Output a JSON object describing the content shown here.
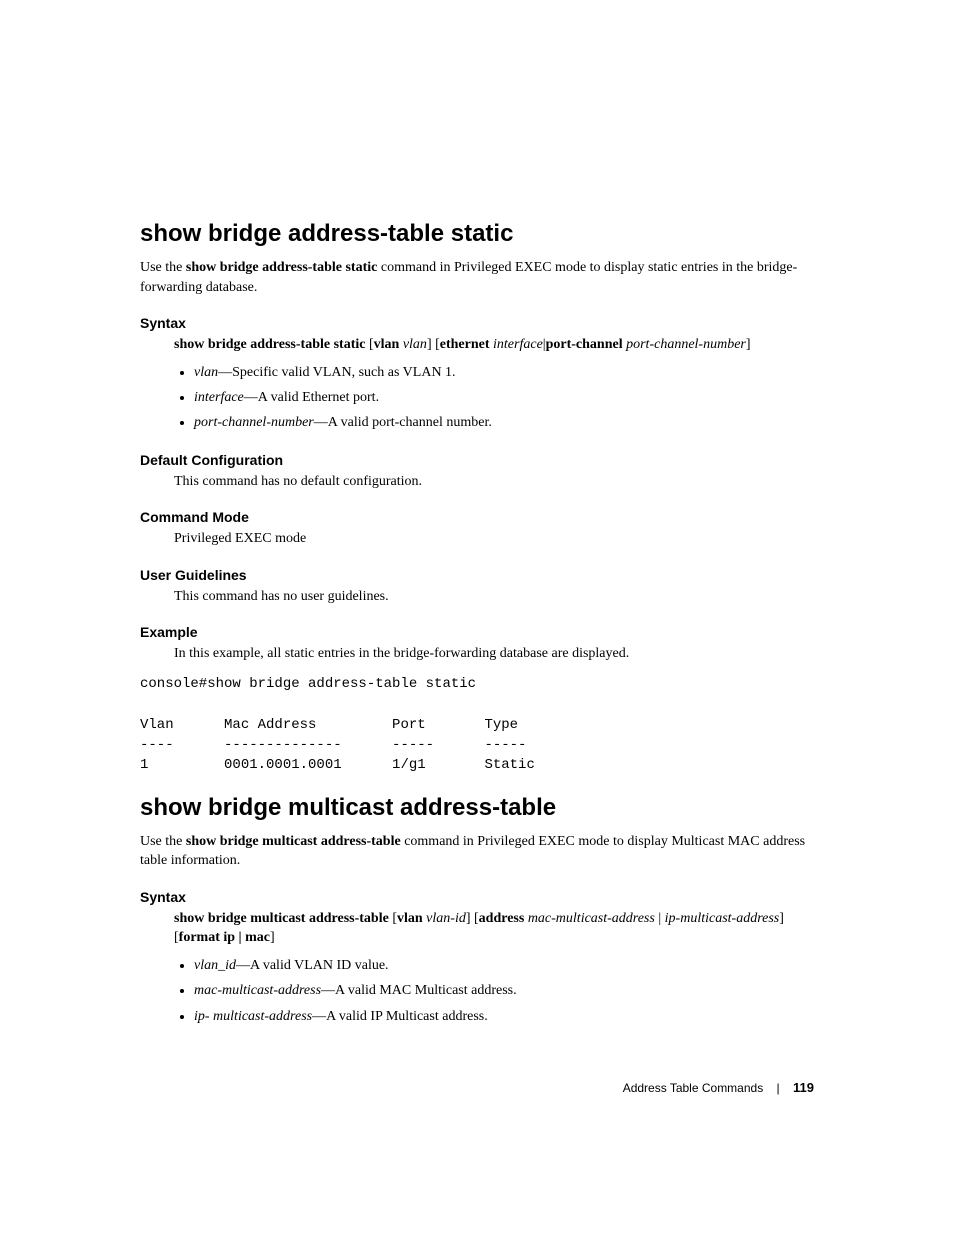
{
  "section1": {
    "title": "show bridge address-table static",
    "intro_pre": "Use the ",
    "intro_bold": "show bridge address-table static",
    "intro_post": " command in Privileged EXEC mode to display static entries in the bridge-forwarding database.",
    "syntax": {
      "heading": "Syntax",
      "line_b1": "show bridge address-table static",
      "line_t1": " [",
      "line_b2": "vlan",
      "line_i1": " vlan",
      "line_t2": "] [",
      "line_b3": "ethernet",
      "line_i2": " interface",
      "line_t3": "|",
      "line_b4": "port-channel",
      "line_i3": " port-channel-number",
      "line_t4": "]",
      "bullets": [
        {
          "term": "vlan",
          "desc": "—Specific valid VLAN, such as VLAN 1."
        },
        {
          "term": "interface",
          "desc": "—A valid Ethernet port."
        },
        {
          "term": "port-channel-number",
          "desc": "—A valid port-channel number."
        }
      ]
    },
    "default_config": {
      "heading": "Default Configuration",
      "text": "This command has no default configuration."
    },
    "command_mode": {
      "heading": "Command Mode",
      "text": "Privileged EXEC mode"
    },
    "user_guidelines": {
      "heading": "User Guidelines",
      "text": "This command has no user guidelines."
    },
    "example": {
      "heading": "Example",
      "text": "In this example, all static entries in the bridge-forwarding database are displayed.",
      "code": "console#show bridge address-table static\n\nVlan      Mac Address         Port       Type\n----      --------------      -----      -----\n1         0001.0001.0001      1/g1       Static"
    }
  },
  "section2": {
    "title": "show bridge multicast address-table",
    "intro_pre": "Use the ",
    "intro_bold": "show bridge multicast address-table",
    "intro_post": " command in Privileged EXEC mode to display Multicast MAC address table information.",
    "syntax": {
      "heading": "Syntax",
      "line_b1": "show bridge multicast address-table",
      "line_t1": " [",
      "line_b2": "vlan",
      "line_i1": " vlan-id",
      "line_t2": "] [",
      "line_b3": "address",
      "line_i2": " mac-multicast-address",
      "line_t3": " | ",
      "line_i3": "ip-multicast-address",
      "line_t4": "] [",
      "line_b4": "format ip | mac",
      "line_t5": "]",
      "bullets": [
        {
          "term": "vlan_id",
          "desc": "—A valid VLAN ID value."
        },
        {
          "term": "mac-multicast-address",
          "desc": "—A valid MAC Multicast address."
        },
        {
          "term": "ip- multicast-address",
          "desc": "—A valid IP Multicast address."
        }
      ]
    }
  },
  "footer": {
    "section": "Address Table Commands",
    "page": "119"
  }
}
